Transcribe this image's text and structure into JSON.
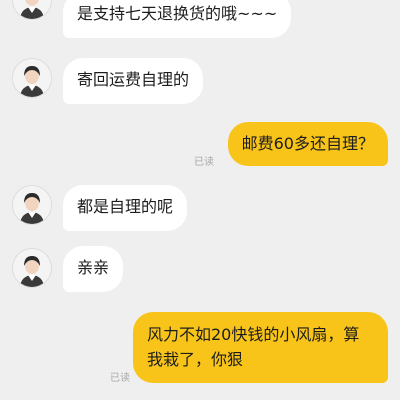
{
  "chat": {
    "messages": [
      {
        "side": "in",
        "text": "是支持七天退换货的哦~~~",
        "avatar": "agent-avatar"
      },
      {
        "side": "in",
        "text": "寄回运费自理的",
        "avatar": "agent-avatar"
      },
      {
        "side": "out",
        "text": "邮费60多还自理？",
        "status": "已读"
      },
      {
        "side": "in",
        "text": "都是自理的呢",
        "avatar": "agent-avatar"
      },
      {
        "side": "in",
        "text": "亲亲",
        "avatar": "agent-avatar"
      },
      {
        "side": "out",
        "text": "风力不如20快钱的小风扇，算我栽了，你狠",
        "status": "已读"
      }
    ]
  },
  "colors": {
    "background": "#efefef",
    "incoming_bubble": "#ffffff",
    "outgoing_bubble": "#f8c41a"
  }
}
